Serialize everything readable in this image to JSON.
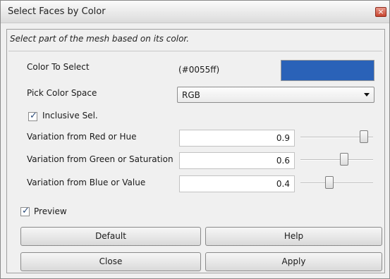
{
  "window": {
    "title": "Select Faces by Color",
    "close_glyph": "×"
  },
  "description": "Select part of the mesh based on its color.",
  "color_to_select": {
    "label": "Color To Select",
    "hex": "(#0055ff)",
    "swatch_color": "#2a62b8"
  },
  "color_space": {
    "label": "Pick Color Space",
    "value": "RGB"
  },
  "inclusive": {
    "label": "Inclusive Sel.",
    "checked": true
  },
  "variations": [
    {
      "label": "Variation from Red or Hue",
      "value": "0.9"
    },
    {
      "label": "Variation from Green or Saturation",
      "value": "0.6"
    },
    {
      "label": "Variation from Blue or Value",
      "value": "0.4"
    }
  ],
  "preview": {
    "label": "Preview",
    "checked": true
  },
  "buttons": {
    "default": "Default",
    "help": "Help",
    "close": "Close",
    "apply": "Apply"
  }
}
